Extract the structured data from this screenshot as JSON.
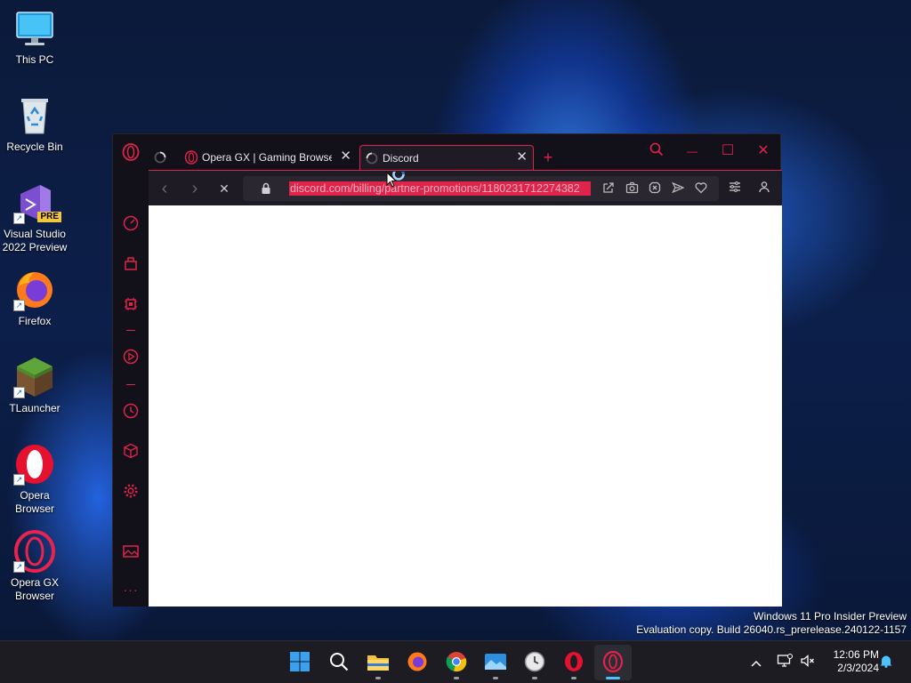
{
  "desktop": {
    "icons": [
      {
        "label_line1": "This PC",
        "label_line2": ""
      },
      {
        "label_line1": "Recycle Bin",
        "label_line2": ""
      },
      {
        "label_line1": "Visual Studio",
        "label_line2": "2022 Preview",
        "badge": "PRE"
      },
      {
        "label_line1": "Firefox",
        "label_line2": ""
      },
      {
        "label_line1": "TLauncher",
        "label_line2": ""
      },
      {
        "label_line1": "Opera",
        "label_line2": "Browser"
      },
      {
        "label_line1": "Opera GX",
        "label_line2": "Browser"
      }
    ],
    "shortcut_glyph": "↗"
  },
  "browser": {
    "tabs": [
      {
        "label": "Opera GX | Gaming Browse",
        "close": "✕"
      },
      {
        "label": "Discord",
        "close": "✕"
      }
    ],
    "new_tab": "+",
    "window_controls": {
      "search": "⌕",
      "minimize": "—",
      "maximize": "☐",
      "close": "✕"
    },
    "nav": {
      "back": "‹",
      "forward": "›",
      "stop": "✕"
    },
    "url": "discord.com/billing/partner-promotions/1180231712274382",
    "sidebar_more": "···",
    "accent_color": "#e0234a"
  },
  "watermark": {
    "line1": "Windows 11 Pro Insider Preview",
    "line2": "Evaluation copy. Build 26040.rs_prerelease.240122-1157"
  },
  "taskbar": {
    "apps": [
      "start-icon",
      "search-icon",
      "file-explorer-icon",
      "firefox-icon",
      "chrome-icon",
      "photos-icon",
      "clock-app-icon",
      "opera-icon",
      "opera-gx-icon"
    ],
    "tray_chevron": "^",
    "time": "12:06 PM",
    "date": "2/3/2024"
  }
}
